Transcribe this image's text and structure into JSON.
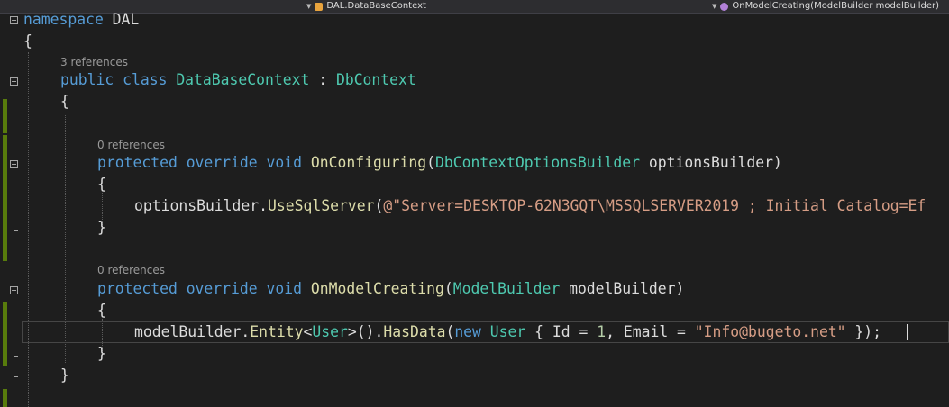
{
  "nav": {
    "class_combo": "DAL.DataBaseContext",
    "member_combo": "OnModelCreating(ModelBuilder modelBuilder)"
  },
  "codelens": {
    "class_refs": "3 references",
    "configuring_refs": "0 references",
    "modelcreating_refs": "0 references"
  },
  "code": {
    "l1_kw": "namespace",
    "l1_name": " DAL",
    "brace_open": "{",
    "brace_close": "}",
    "l3_public": "public",
    "l3_class": "class",
    "l3_type": "DataBaseContext",
    "l3_colon": " : ",
    "l3_base": "DbContext",
    "l5_protected": "protected",
    "l5_override": "override",
    "l5_void": "void",
    "l5_method": "OnConfiguring",
    "l5_paren": "(",
    "l5_ptype": "DbContextOptionsBuilder",
    "l5_pname": " optionsBuilder)",
    "l7_obj": "optionsBuilder.",
    "l7_method": "UseSqlServer",
    "l7_paren": "(",
    "l7_string": "@\"Server=DESKTOP-62N3GQT\\MSSQLSERVER2019 ; Initial Catalog=Ef",
    "l10_method": "OnModelCreating",
    "l10_ptype": "ModelBuilder",
    "l10_pname": " modelBuilder)",
    "l12_obj": "modelBuilder.",
    "l12_entity": "Entity",
    "l12_lt": "<",
    "l12_user": "User",
    "l12_gt": ">().",
    "l12_hasdata": "HasData",
    "l12_paren": "(",
    "l12_new": "new",
    "l12_user2": "User",
    "l12_brace": " { Id = ",
    "l12_num": "1",
    "l12_email": ", Email = ",
    "l12_str": "\"Info@bugeto.net\"",
    "l12_end": " });"
  }
}
